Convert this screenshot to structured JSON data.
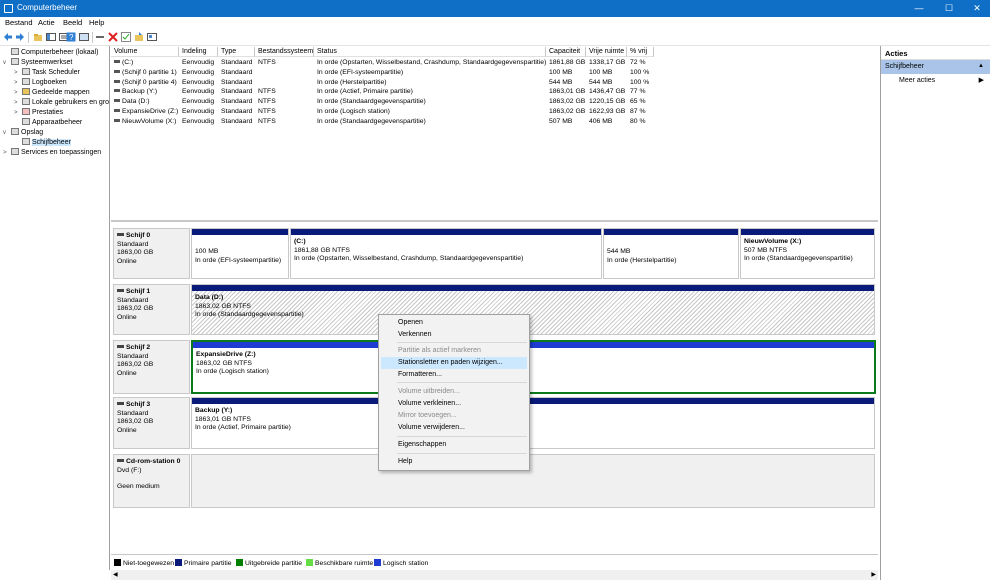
{
  "window": {
    "title": "Computerbeheer"
  },
  "menubar": [
    "Bestand",
    "Actie",
    "Beeld",
    "Help"
  ],
  "tree": [
    {
      "label": "Computerbeheer (lokaal)",
      "level": 0,
      "arrow": "",
      "selected": false
    },
    {
      "label": "Systeemwerkset",
      "level": 1,
      "arrow": "v",
      "selected": false
    },
    {
      "label": "Task Scheduler",
      "level": 2,
      "arrow": ">",
      "selected": false
    },
    {
      "label": "Logboeken",
      "level": 2,
      "arrow": ">",
      "selected": false
    },
    {
      "label": "Gedeelde mappen",
      "level": 2,
      "arrow": ">",
      "selected": false
    },
    {
      "label": "Lokale gebruikers en gro",
      "level": 2,
      "arrow": ">",
      "selected": false
    },
    {
      "label": "Prestaties",
      "level": 2,
      "arrow": ">",
      "selected": false
    },
    {
      "label": "Apparaatbeheer",
      "level": 2,
      "arrow": "",
      "selected": false
    },
    {
      "label": "Opslag",
      "level": 1,
      "arrow": "v",
      "selected": false
    },
    {
      "label": "Schijfbeheer",
      "level": 2,
      "arrow": "",
      "selected": true
    },
    {
      "label": "Services en toepassingen",
      "level": 1,
      "arrow": ">",
      "selected": false
    }
  ],
  "volumes": {
    "headers": [
      "Volume",
      "Indeling",
      "Type",
      "Bestandssysteem",
      "Status",
      "Capaciteit",
      "Vrije ruimte",
      "% vrij"
    ],
    "rows": [
      [
        "(C:)",
        "Eenvoudig",
        "Standaard",
        "NTFS",
        "In orde (Opstarten, Wisselbestand, Crashdump, Standaardgegevenspartitie)",
        "1861,88 GB",
        "1338,17 GB",
        "72 %"
      ],
      [
        "(Schijf 0 partitie 1)",
        "Eenvoudig",
        "Standaard",
        "",
        "In orde (EFI-systeempartitie)",
        "100 MB",
        "100 MB",
        "100 %"
      ],
      [
        "(Schijf 0 partitie 4)",
        "Eenvoudig",
        "Standaard",
        "",
        "In orde (Herstelpartitie)",
        "544 MB",
        "544 MB",
        "100 %"
      ],
      [
        "Backup (Y:)",
        "Eenvoudig",
        "Standaard",
        "NTFS",
        "In orde (Actief, Primaire partitie)",
        "1863,01 GB",
        "1436,47 GB",
        "77 %"
      ],
      [
        "Data (D:)",
        "Eenvoudig",
        "Standaard",
        "NTFS",
        "In orde (Standaardgegevenspartitie)",
        "1863,02 GB",
        "1220,15 GB",
        "65 %"
      ],
      [
        "ExpansieDrive (Z:)",
        "Eenvoudig",
        "Standaard",
        "NTFS",
        "In orde (Logisch station)",
        "1863,02 GB",
        "1622,93 GB",
        "87 %"
      ],
      [
        "NieuwVolume (X:)",
        "Eenvoudig",
        "Standaard",
        "NTFS",
        "In orde (Standaardgegevenspartitie)",
        "507 MB",
        "406 MB",
        "80 %"
      ]
    ]
  },
  "disks": [
    {
      "name": "Schijf 0",
      "type": "Standaard",
      "size": "1863,00 GB",
      "state": "Online",
      "partitions": [
        {
          "name": "",
          "line1": "100 MB",
          "line2": "In orde (EFI-systeempartitie)"
        },
        {
          "name": "(C:)",
          "line1": "1861,88 GB NTFS",
          "line2": "In orde (Opstarten, Wisselbestand, Crashdump, Standaardgegevenspartitie)"
        },
        {
          "name": "",
          "line1": "544 MB",
          "line2": "In orde (Herstelpartitie)"
        },
        {
          "name": "NieuwVolume  (X:)",
          "line1": "507 MB NTFS",
          "line2": "In orde (Standaardgegevenspartitie)"
        }
      ]
    },
    {
      "name": "Schijf 1",
      "type": "Standaard",
      "size": "1863,02 GB",
      "state": "Online",
      "partitions": [
        {
          "name": "Data  (D:)",
          "line1": "1863,02 GB NTFS",
          "line2": "In orde (Standaardgegevenspartitie)"
        }
      ]
    },
    {
      "name": "Schijf 2",
      "type": "Standaard",
      "size": "1863,02 GB",
      "state": "Online",
      "partitions": [
        {
          "name": "ExpansieDrive  (Z:)",
          "line1": "1863,02 GB NTFS",
          "line2": "In orde (Logisch station)"
        }
      ]
    },
    {
      "name": "Schijf 3",
      "type": "Standaard",
      "size": "1863,02 GB",
      "state": "Online",
      "partitions": [
        {
          "name": "Backup  (Y:)",
          "line1": "1863,01 GB NTFS",
          "line2": "In orde (Actief, Primaire partitie)"
        }
      ]
    },
    {
      "name": "Cd-rom-station 0",
      "type": "Dvd (F:)",
      "size": "",
      "state": "Geen medium",
      "partitions": []
    }
  ],
  "legend": [
    {
      "label": "Niet-toegewezen",
      "color": "#000000"
    },
    {
      "label": "Primaire partitie",
      "color": "#0a1a7a"
    },
    {
      "label": "Uitgebreide partitie",
      "color": "#008000"
    },
    {
      "label": "Beschikbare ruimte",
      "color": "#66dd44"
    },
    {
      "label": "Logisch station",
      "color": "#1e3cd2"
    }
  ],
  "actions": {
    "title": "Acties",
    "section": "Schijfbeheer",
    "more": "Meer acties"
  },
  "context_menu": [
    {
      "label": "Openen",
      "disabled": false,
      "highlighted": false
    },
    {
      "label": "Verkennen",
      "disabled": false,
      "highlighted": false
    },
    {
      "label": "Partitie als actief markeren",
      "disabled": true,
      "highlighted": false
    },
    {
      "label": "Stationsletter en paden wijzigen...",
      "disabled": false,
      "highlighted": true
    },
    {
      "label": "Formatteren...",
      "disabled": false,
      "highlighted": false
    },
    {
      "label": "Volume uitbreiden...",
      "disabled": true,
      "highlighted": false
    },
    {
      "label": "Volume verkleinen...",
      "disabled": false,
      "highlighted": false
    },
    {
      "label": "Mirror toevoegen...",
      "disabled": true,
      "highlighted": false
    },
    {
      "label": "Volume verwijderen...",
      "disabled": false,
      "highlighted": false
    },
    {
      "label": "Eigenschappen",
      "disabled": false,
      "highlighted": false
    },
    {
      "label": "Help",
      "disabled": false,
      "highlighted": false
    }
  ]
}
